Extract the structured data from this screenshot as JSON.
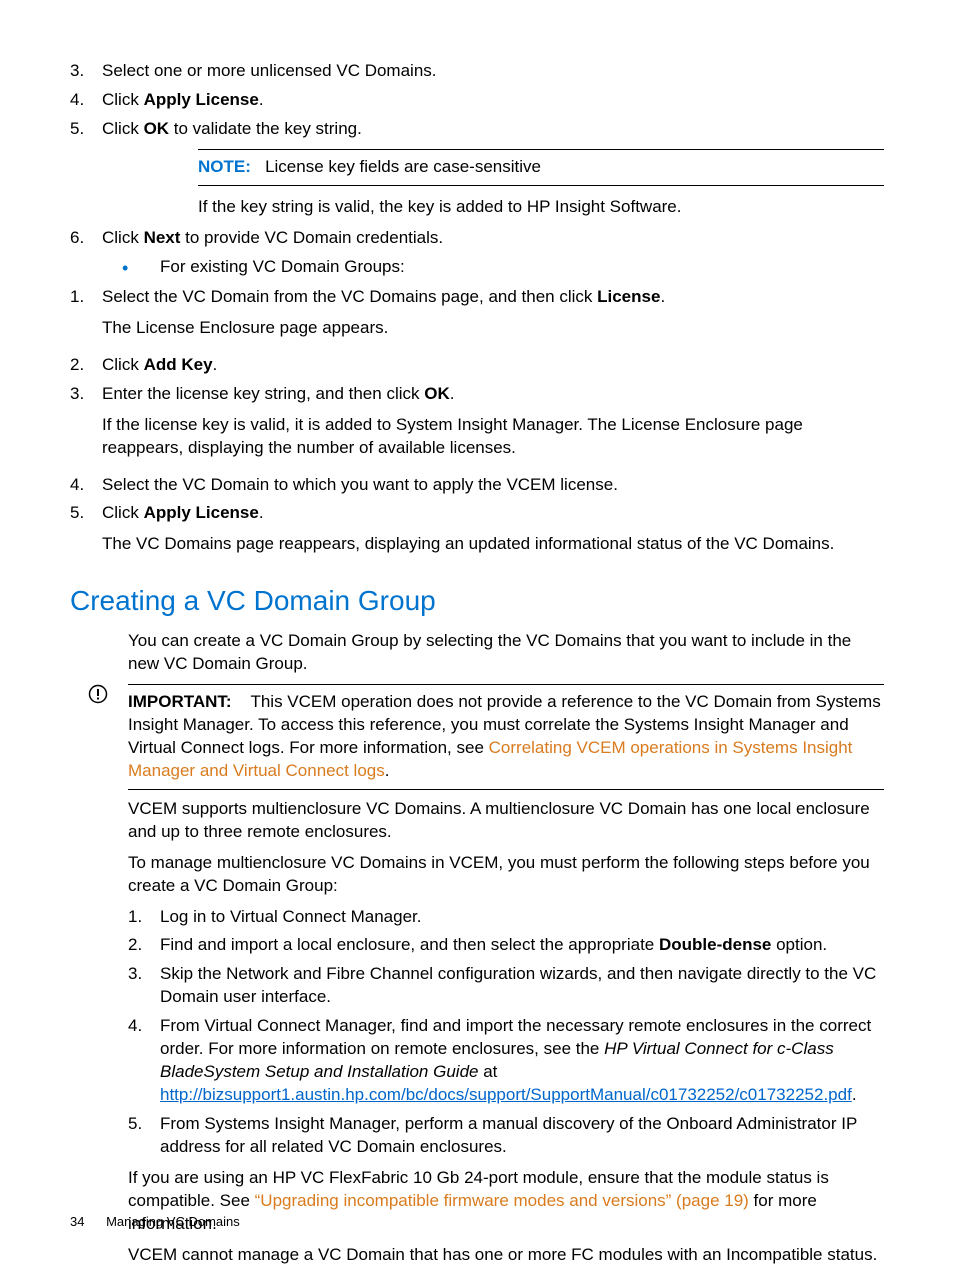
{
  "top_list": {
    "items": [
      {
        "num": "3.",
        "text": "Select one or more unlicensed VC Domains."
      },
      {
        "num": "4.",
        "pre": "Click ",
        "bold": "Apply License",
        "post": "."
      },
      {
        "num": "5.",
        "pre": "Click ",
        "bold": "OK",
        "post": " to validate the key string."
      }
    ]
  },
  "note": {
    "label": "NOTE:",
    "text": "License key fields are case-sensitive"
  },
  "after_note": "If the key string is valid, the key is added to HP Insight Software.",
  "item6": {
    "num": "6.",
    "pre": "Click ",
    "bold": "Next",
    "post": " to provide VC Domain credentials."
  },
  "bullet_intro": "For existing VC Domain Groups:",
  "existing_list": {
    "i1": {
      "num": "1.",
      "pre": "Select the VC Domain from the VC Domains page, and then click ",
      "bold": "License",
      "post": ".",
      "sub": "The License Enclosure page appears."
    },
    "i2": {
      "num": "2.",
      "pre": "Click ",
      "bold": "Add Key",
      "post": "."
    },
    "i3": {
      "num": "3.",
      "pre": "Enter the license key string, and then click ",
      "bold": "OK",
      "post": ".",
      "sub": "If the license key is valid, it is added to System Insight Manager. The License Enclosure page reappears, displaying the number of available licenses."
    },
    "i4": {
      "num": "4.",
      "text": "Select the VC Domain to which you want to apply the VCEM license."
    },
    "i5": {
      "num": "5.",
      "pre": "Click ",
      "bold": "Apply License",
      "post": ".",
      "sub": "The VC Domains page reappears, displaying an updated informational status of the VC Domains."
    }
  },
  "heading": "Creating a VC Domain Group",
  "intro_para": "You can create a VC Domain Group by selecting the VC Domains that you want to include in the new VC Domain Group.",
  "important": {
    "label": "IMPORTANT:",
    "text1": "This VCEM operation does not provide a reference to the VC Domain from Systems Insight Manager. To access this reference, you must correlate the Systems Insight Manager and Virtual Connect logs. For more information, see ",
    "link": "Correlating VCEM operations in Systems Insight Manager and Virtual Connect logs",
    "text2": "."
  },
  "p2": "VCEM supports multienclosure VC Domains. A multienclosure VC Domain has one local enclosure and up to three remote enclosures.",
  "p3": "To manage multienclosure VC Domains in VCEM, you must perform the following steps before you create a VC Domain Group:",
  "steps": {
    "s1": {
      "num": "1.",
      "text": "Log in to Virtual Connect Manager."
    },
    "s2": {
      "num": "2.",
      "pre": "Find and import a local enclosure, and then select the appropriate ",
      "bold": "Double-dense",
      "post": " option."
    },
    "s3": {
      "num": "3.",
      "text": "Skip the Network and Fibre Channel configuration wizards, and then navigate directly to the VC Domain user interface."
    },
    "s4": {
      "num": "4.",
      "pre": "From Virtual Connect Manager, find and import the necessary remote enclosures in the correct order.  For more information on remote enclosures, see the ",
      "italic": "HP Virtual Connect for c-Class BladeSystem Setup and Installation Guide",
      "mid": " at ",
      "link": "http://bizsupport1.austin.hp.com/bc/docs/support/SupportManual/c01732252/c01732252.pdf",
      "post": "."
    },
    "s5": {
      "num": "5.",
      "text": "From Systems Insight Manager, perform a manual discovery of the Onboard Administrator IP address for all related VC Domain enclosures."
    }
  },
  "p4": {
    "pre": "If you are using an HP VC FlexFabric 10 Gb 24-port module, ensure that the module status is compatible. See ",
    "link": "“Upgrading incompatible firmware modes and versions” (page 19)",
    "post": " for more information."
  },
  "p5": "VCEM cannot manage a VC Domain that has one or more FC modules with an Incompatible status.",
  "footer": {
    "page": "34",
    "title": "Managing VC Domains"
  }
}
